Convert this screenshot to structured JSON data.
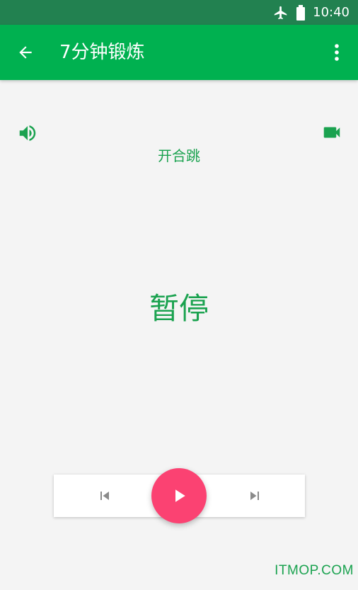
{
  "status_bar": {
    "time": "10:40",
    "icons": [
      "airplane-mode-icon",
      "battery-icon"
    ]
  },
  "app_bar": {
    "title": "7分钟锻炼",
    "icons": [
      "back-arrow-icon",
      "more-vert-icon"
    ],
    "color": "#00b150"
  },
  "main": {
    "exercise_name": "开合跳",
    "state_text": "暂停",
    "icons": [
      "volume-icon",
      "video-camera-icon"
    ],
    "text_color": "#1aa24f"
  },
  "controls": {
    "icons": [
      "skip-previous-icon",
      "play-icon",
      "skip-next-icon"
    ],
    "play_color": "#fb4272"
  },
  "watermark": "ITMOP.COM"
}
